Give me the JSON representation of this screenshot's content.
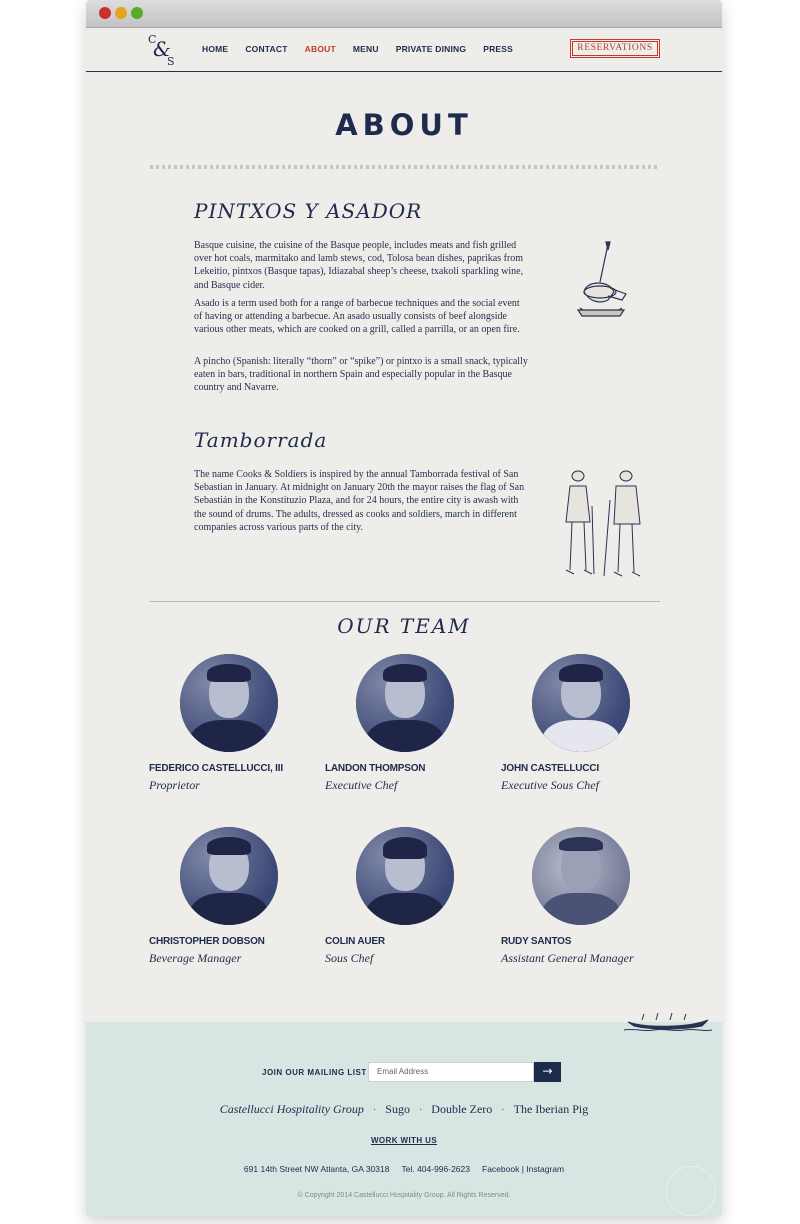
{
  "window": {
    "buttons": [
      "close",
      "minimize",
      "zoom"
    ]
  },
  "logo": {
    "c": "C",
    "amp": "&",
    "s": "S"
  },
  "nav": {
    "items": [
      "HOME",
      "CONTACT",
      "ABOUT",
      "MENU",
      "PRIVATE DINING",
      "PRESS"
    ],
    "active": "ABOUT",
    "reservations": "RESERVATIONS"
  },
  "page": {
    "title": "ABOUT"
  },
  "sections": [
    {
      "heading": "PINTXOS Y ASADOR",
      "paragraphs": [
        "Basque cuisine, the cuisine of the Basque people, includes meats and fish grilled over hot coals, marmitako and lamb stews, cod, Tolosa bean dishes, paprikas from Lekeitio, pintxos (Basque tapas), Idiazabal sheep’s cheese, txakoli sparkling wine, and Basque cider.",
        "Asado is a term used both for a range of barbecue techniques and the social event of having or attending a barbecue. An asado usually consists of beef alongside various other meats, which are cooked on a grill, called a parrilla, or an open fire.",
        "A pincho (Spanish: literally “thorn” or “spike”) or pintxo is a small snack, typically eaten in bars, traditional in northern Spain and especially popular in the Basque country and Navarre."
      ]
    },
    {
      "heading": "Tamborrada",
      "paragraphs": [
        "The name Cooks & Soldiers is inspired by the annual Tamborrada festival of San Sebastian in January. At midnight on January 20th the mayor raises the flag of San Sebastián in the Konstituzio Plaza, and for 24 hours, the entire city is awash with the sound of drums. The adults, dressed as cooks and soldiers, march in different companies across various parts of the city."
      ]
    }
  ],
  "team": {
    "title": "OUR TEAM",
    "members": [
      {
        "name": "FEDERICO CASTELLUCCI, III",
        "role": "Proprietor"
      },
      {
        "name": "LANDON THOMPSON",
        "role": "Executive Chef"
      },
      {
        "name": "JOHN CASTELLUCCI",
        "role": "Executive Sous Chef"
      },
      {
        "name": "CHRISTOPHER DOBSON",
        "role": "Beverage Manager"
      },
      {
        "name": "COLIN AUER",
        "role": "Sous Chef"
      },
      {
        "name": "RUDY SANTOS",
        "role": "Assistant General Manager"
      }
    ]
  },
  "footer": {
    "join_label": "JOIN OUR MAILING LIST",
    "email_placeholder": "Email Address",
    "submit_icon": "arrow-right-icon",
    "brands": [
      "Castellucci Hospitality Group",
      "Sugo",
      "Double Zero",
      "The Iberian Pig"
    ],
    "separator": "·",
    "work_with_us": "WORK WITH US",
    "address": "691 14th Street NW Atlanta, GA 30318",
    "phone": "Tel. 404-996-2623",
    "social": "Facebook | Instagram",
    "copyright": "© Copyright 2014 Castellucci Hospitality Group. All Rights Reserved."
  },
  "colors": {
    "navy": "#1f2b4d",
    "accent_red": "#c0392b",
    "page_bg": "#efedea",
    "footer_bg": "#d8e6e3"
  }
}
